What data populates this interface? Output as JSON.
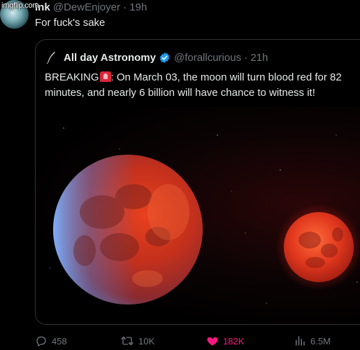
{
  "watermark": "imgflip.com",
  "tweet": {
    "author_name": "ink",
    "handle": "@DewEnjoyer",
    "time": "19h",
    "text": "For fuck's sake"
  },
  "quote": {
    "author_name": "All day Astronomy",
    "handle": "@forallcurious",
    "time": "21h",
    "text_prefix": "BREAKING",
    "text_body": ": On March 03, the moon will turn blood red for 82 minutes, and nearly 6 billion will have chance to witness it!"
  },
  "actions": {
    "replies": "458",
    "reposts": "10K",
    "likes": "182K",
    "views": "6.5M"
  },
  "colors": {
    "verified": "#1d9bf0",
    "like_active": "#f91880",
    "moon_red": "#d2331e"
  },
  "icons": [
    "avatar",
    "quill-icon",
    "verified-badge-icon",
    "siren-emoji-icon",
    "reply-icon",
    "repost-icon",
    "heart-icon",
    "views-icon"
  ]
}
